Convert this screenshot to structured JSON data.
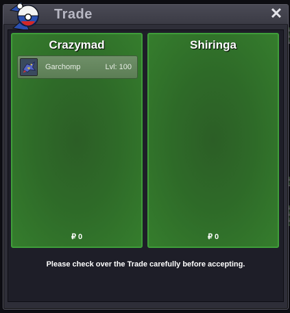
{
  "window": {
    "title": "Trade",
    "close_icon": "close-icon",
    "logo_icon": "pokeball-logo-icon"
  },
  "trade": {
    "left_player": {
      "name": "Crazymad",
      "money_symbol": "₽",
      "money": "0",
      "pokemon": [
        {
          "name": "Garchomp",
          "level_text": "Lvl: 100",
          "icon": "garchomp-sprite-icon"
        }
      ]
    },
    "right_player": {
      "name": "Shiringa",
      "money_symbol": "₽",
      "money": "0",
      "pokemon": []
    },
    "notice": "Please check over the Trade carefully before accepting."
  },
  "colors": {
    "panel_border": "#3f9e3a",
    "panel_fill": "#2e6a28",
    "window_bg": "#2e2e38",
    "title_text": "#b8b8c4"
  }
}
